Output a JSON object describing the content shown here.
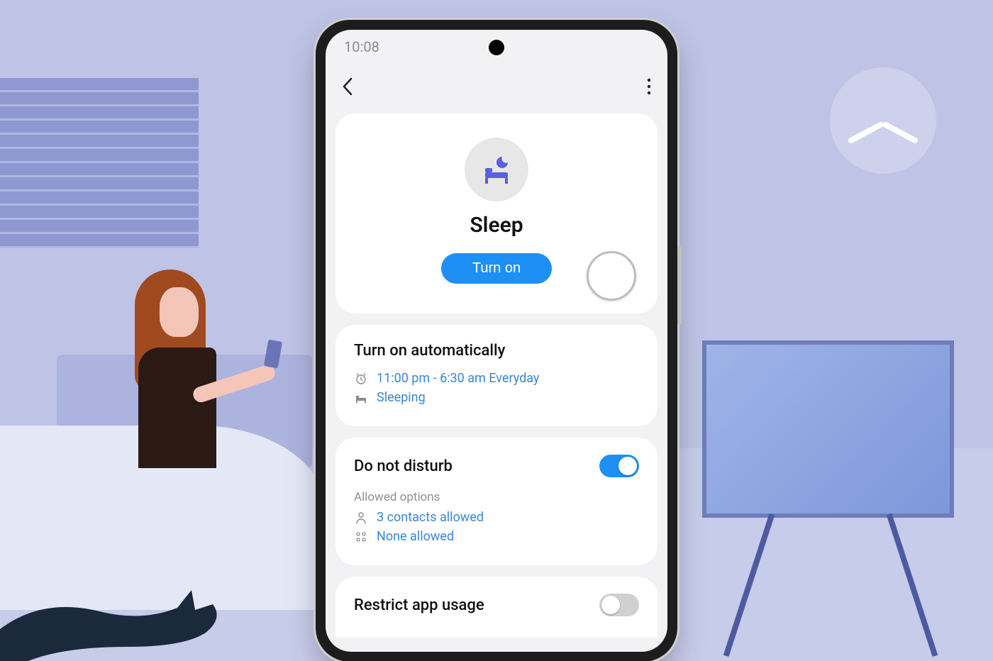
{
  "status_time": "10:08",
  "mode": {
    "title": "Sleep",
    "button_label": "Turn on",
    "icon_name": "bed-moon-icon"
  },
  "auto": {
    "title": "Turn on automatically",
    "schedule": "11:00 pm - 6:30 am Everyday",
    "condition": "Sleeping"
  },
  "dnd": {
    "title": "Do not disturb",
    "enabled": true,
    "allowed_label": "Allowed options",
    "contacts": "3 contacts allowed",
    "apps": "None allowed"
  },
  "restrict": {
    "title": "Restrict app usage",
    "enabled": false
  },
  "colors": {
    "accent": "#1e90f5",
    "link": "#3a86d6"
  }
}
